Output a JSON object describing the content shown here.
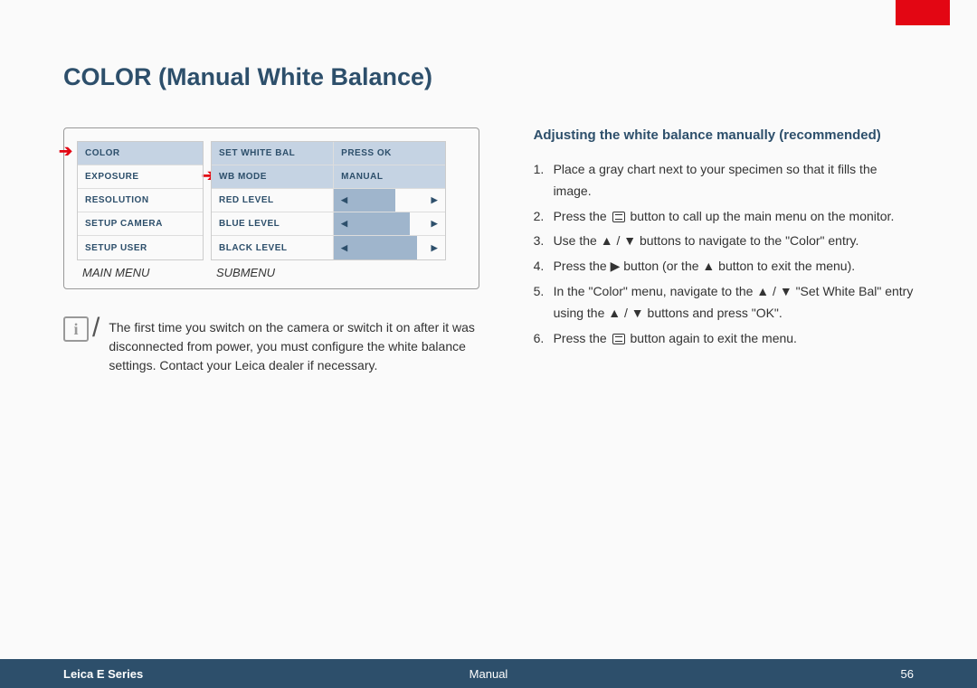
{
  "title": "COLOR (Manual White Balance)",
  "mainMenu": {
    "label": "MAIN MENU",
    "items": [
      "COLOR",
      "EXPOSURE",
      "RESOLUTION",
      "SETUP CAMERA",
      "SETUP USER"
    ]
  },
  "subMenu": {
    "label": "SUBMENU",
    "rows": [
      {
        "label": "SET WHITE BAL",
        "value": "PRESS OK",
        "type": "text",
        "hl": true
      },
      {
        "label": "WB MODE",
        "value": "MANUAL",
        "type": "text",
        "hl": true
      },
      {
        "label": "RED LEVEL",
        "type": "slider"
      },
      {
        "label": "BLUE LEVEL",
        "type": "slider"
      },
      {
        "label": "BLACK LEVEL",
        "type": "slider"
      }
    ]
  },
  "infoNote": "The ﬁrst time you switch on the camera or switch it on after it was disconnected from power, you must conﬁgure the white balance settings. Contact your Leica dealer if necessary.",
  "heading2": "Adjusting the white balance manually (recommended)",
  "steps": [
    {
      "n": "1.",
      "t": "Place a gray chart next to your specimen so that it ﬁlls the image."
    },
    {
      "n": "2.",
      "t_pre": "Press the ",
      "glyph": "menu",
      "t_post": " button to call up the main menu on the monitor."
    },
    {
      "n": "3.",
      "t": "Use the ▲ / ▼ buttons to navigate to the \"Color\" entry."
    },
    {
      "n": "4.",
      "t": "Press the ▶ button (or the ▲ button to exit the menu)."
    },
    {
      "n": "5.",
      "t": "In the \"Color\" menu, navigate to the ▲ / ▼ \"Set White Bal\" entry using the ▲ / ▼ buttons and press \"OK\"."
    },
    {
      "n": "6.",
      "t_pre": "Press the ",
      "glyph": "menu",
      "t_post": " button again to exit the menu."
    }
  ],
  "footer": {
    "left": "Leica E Series",
    "center": "Manual",
    "right": "56"
  }
}
